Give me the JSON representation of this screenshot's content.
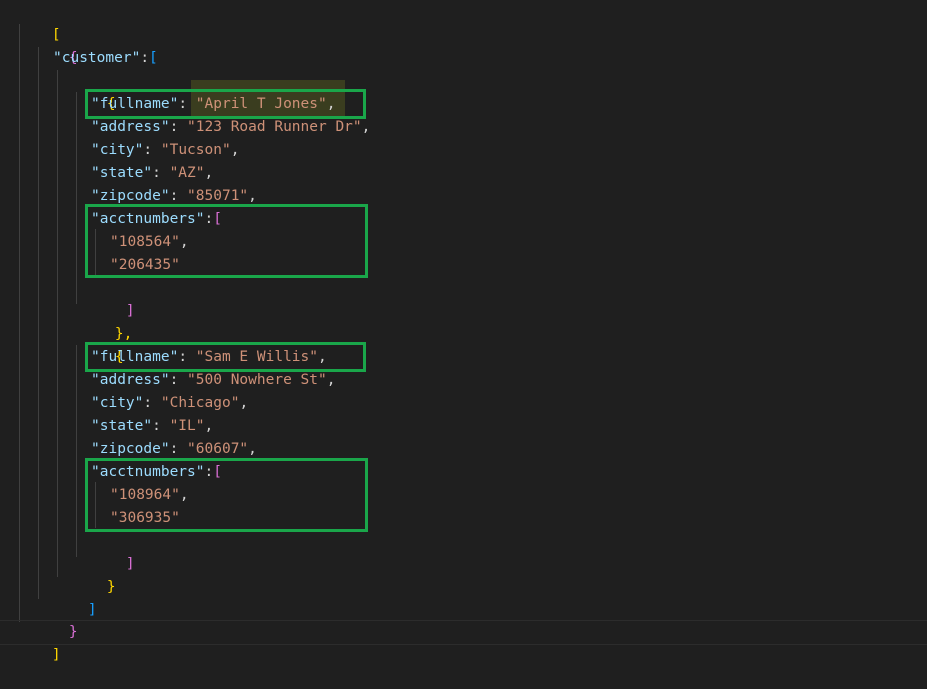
{
  "editor": {
    "root_open": "[",
    "root_close": "]",
    "obj_open": "{",
    "obj_close": "}",
    "customer_key": "\"customer\"",
    "customer_sep": ":",
    "customer_open": "[",
    "customer_close": "]",
    "records": [
      {
        "open": "{",
        "close": "},",
        "fullname_key": "\"fullname\"",
        "fullname_val": "\"April T Jones\"",
        "address_key": "\"address\"",
        "address_val": "\"123 Road Runner Dr\"",
        "city_key": "\"city\"",
        "city_val": "\"Tucson\"",
        "state_key": "\"state\"",
        "state_val": "\"AZ\"",
        "zipcode_key": "\"zipcode\"",
        "zipcode_val": "\"85071\"",
        "acct_key": "\"acctnumbers\"",
        "acct_open": "[",
        "acct_close": "]",
        "acct_1": "\"108564\"",
        "acct_2": "\"206435\""
      },
      {
        "open": "{",
        "close": "}",
        "fullname_key": "\"fullname\"",
        "fullname_val": "\"Sam E Willis\"",
        "address_key": "\"address\"",
        "address_val": "\"500 Nowhere St\"",
        "city_key": "\"city\"",
        "city_val": "\"Chicago\"",
        "state_key": "\"state\"",
        "state_val": "\"IL\"",
        "zipcode_key": "\"zipcode\"",
        "zipcode_val": "\"60607\"",
        "acct_key": "\"acctnumbers\"",
        "acct_open": "[",
        "acct_close": "]",
        "acct_1": "\"108964\"",
        "acct_2": "\"306935\""
      }
    ]
  },
  "colors": {
    "background": "#1f1f1f",
    "key": "#9cdcfe",
    "string": "#ce9178",
    "bracket_gold": "#ffd700",
    "bracket_orchid": "#da70d6",
    "bracket_blue": "#179fff",
    "highlight_box": "#1aa64a"
  }
}
